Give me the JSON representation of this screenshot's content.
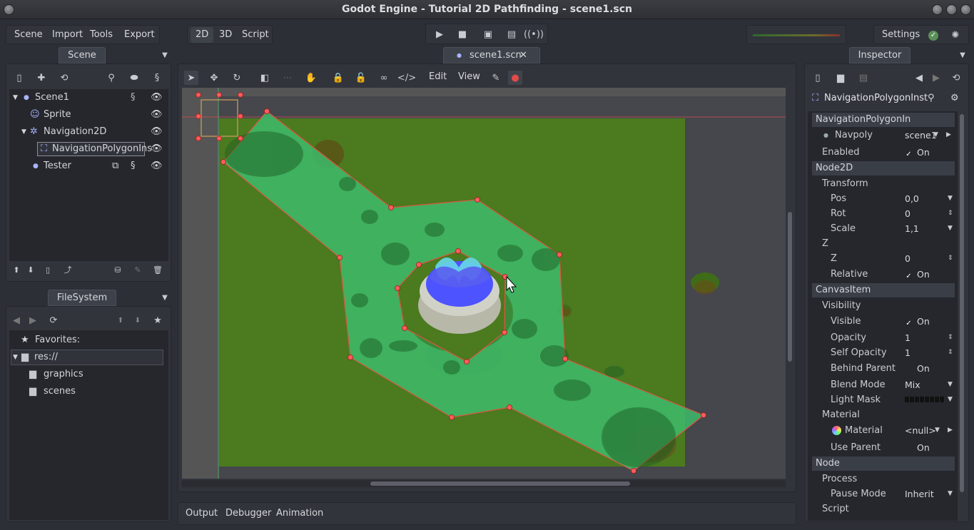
{
  "window": {
    "title": "Godot Engine - Tutorial 2D Pathfinding - scene1.scn"
  },
  "menu": {
    "items": [
      "Scene",
      "Import",
      "Tools",
      "Export"
    ],
    "modes": [
      "2D",
      "3D",
      "Script"
    ],
    "settings_label": "Settings"
  },
  "scene_dock": {
    "tab": "Scene",
    "tree": [
      {
        "label": "Scene1",
        "icon": "node-icon"
      },
      {
        "label": "Sprite",
        "icon": "sprite-icon"
      },
      {
        "label": "Navigation2D",
        "icon": "navigation-icon"
      },
      {
        "label": "NavigationPolygonIns",
        "icon": "navpoly-icon"
      },
      {
        "label": "Tester",
        "icon": "node-icon"
      }
    ]
  },
  "filesystem": {
    "tab": "FileSystem",
    "favorites_label": "Favorites:",
    "items": [
      "res://",
      "graphics",
      "scenes"
    ]
  },
  "editor": {
    "tab_label": "scene1.scn",
    "toolbar": {
      "edit_label": "Edit",
      "view_label": "View"
    }
  },
  "bottom_tabs": [
    "Output",
    "Debugger",
    "Animation"
  ],
  "inspector": {
    "tab": "Inspector",
    "node_name": "NavigationPolygonInst",
    "sections": {
      "navpoly_section": "NavigationPolygonIn",
      "navpoly_label": "Navpoly",
      "navpoly_value": "scene1",
      "enabled_label": "Enabled",
      "enabled_value": "On",
      "node2d": "Node2D",
      "transform": "Transform",
      "pos_label": "Pos",
      "pos_value": "0,0",
      "rot_label": "Rot",
      "rot_value": "0",
      "scale_label": "Scale",
      "scale_value": "1,1",
      "z_group": "Z",
      "z_label": "Z",
      "z_value": "0",
      "relative_label": "Relative",
      "relative_value": "On",
      "canvasitem": "CanvasItem",
      "visibility": "Visibility",
      "visible_label": "Visible",
      "visible_value": "On",
      "opacity_label": "Opacity",
      "opacity_value": "1",
      "self_opacity_label": "Self Opacity",
      "self_opacity_value": "1",
      "behind_parent_label": "Behind Parent",
      "behind_parent_value": "On",
      "blend_mode_label": "Blend Mode",
      "blend_mode_value": "Mix",
      "light_mask_label": "Light Mask",
      "material_group": "Material",
      "material_label": "Material",
      "material_value": "<null>",
      "use_parent_label": "Use Parent",
      "use_parent_value": "On",
      "node": "Node",
      "process": "Process",
      "pause_mode_label": "Pause Mode",
      "pause_mode_value": "Inherit",
      "script": "Script"
    }
  },
  "colors": {
    "accent": "#e24a4a",
    "grass": "#4b7a1f",
    "navpoly_fill": "#3dbb6b",
    "background": "#2c2f36"
  }
}
